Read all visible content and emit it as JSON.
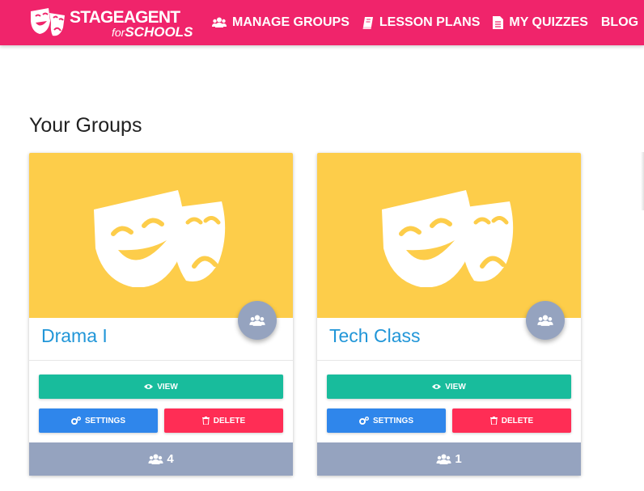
{
  "header": {
    "logo_top": "STAGEAGENT",
    "logo_for": "for",
    "logo_schools": "SCHOOLS",
    "nav": [
      {
        "label": "MANAGE GROUPS",
        "icon": "users-icon"
      },
      {
        "label": "LESSON PLANS",
        "icon": "book-icon"
      },
      {
        "label": "MY QUIZZES",
        "icon": "file-icon"
      },
      {
        "label": "BLOG",
        "icon": ""
      }
    ],
    "colors": {
      "bar": "#f0246b"
    }
  },
  "main": {
    "title": "Your Groups",
    "groups": [
      {
        "name": "Drama I",
        "view": "VIEW",
        "settings": "SETTINGS",
        "delete": "DELETE",
        "members": "4"
      },
      {
        "name": "Tech Class",
        "view": "VIEW",
        "settings": "SETTINGS",
        "delete": "DELETE",
        "members": "1"
      }
    ],
    "colors": {
      "image": "#fdcd4a",
      "view": "#18bc9c",
      "settings": "#2f86eb",
      "delete": "#ff2d55",
      "footer": "#95a3bf",
      "title": "#2196d8"
    }
  }
}
